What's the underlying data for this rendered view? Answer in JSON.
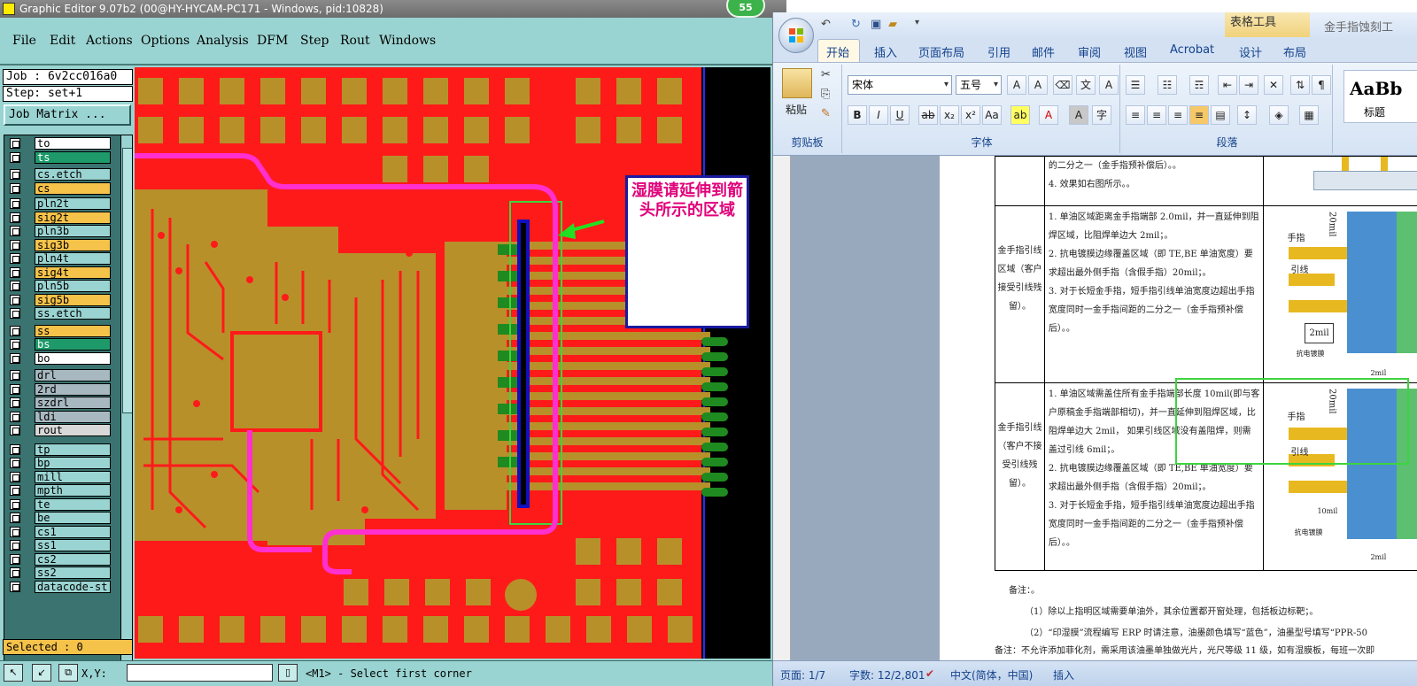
{
  "ge": {
    "title": "Graphic Editor 9.07b2 (00@HY-HYCAM-PC171 - Windows, pid:10828)",
    "badge": "55",
    "menu": [
      "File",
      "Edit",
      "Actions",
      "Options",
      "Analysis",
      "DFM",
      "Step",
      "Rout",
      "Windows"
    ],
    "job": "Job : 6v2cc016a0",
    "step": "Step: set+1",
    "job_matrix": "Job Matrix ...",
    "layers": [
      {
        "name": "to",
        "color": "#ffffff"
      },
      {
        "name": "ts",
        "color": "#1e9a6a"
      },
      {
        "name": "cs.etch",
        "color": "#9ad4d2"
      },
      {
        "name": "cs",
        "color": "#f5c24a"
      },
      {
        "name": "pln2t",
        "color": "#9ad4d2"
      },
      {
        "name": "sig2t",
        "color": "#f5c24a"
      },
      {
        "name": "pln3b",
        "color": "#9ad4d2"
      },
      {
        "name": "sig3b",
        "color": "#f5c24a"
      },
      {
        "name": "pln4t",
        "color": "#9ad4d2"
      },
      {
        "name": "sig4t",
        "color": "#f5c24a"
      },
      {
        "name": "pln5b",
        "color": "#9ad4d2"
      },
      {
        "name": "sig5b",
        "color": "#f5c24a"
      },
      {
        "name": "ss.etch",
        "color": "#9ad4d2"
      },
      {
        "name": "ss",
        "color": "#f5c24a"
      },
      {
        "name": "bs",
        "color": "#1e9a6a"
      },
      {
        "name": "bo",
        "color": "#ffffff"
      },
      {
        "name": "drl",
        "color": "#a8b8c0"
      },
      {
        "name": "2rd",
        "color": "#a8b8c0"
      },
      {
        "name": "szdrl",
        "color": "#a8b8c0"
      },
      {
        "name": "ldi",
        "color": "#a8b8c0"
      },
      {
        "name": "rout",
        "color": "#d8d8d8"
      },
      {
        "name": "tp",
        "color": "#9ad4d2"
      },
      {
        "name": "bp",
        "color": "#9ad4d2"
      },
      {
        "name": "mill",
        "color": "#9ad4d2"
      },
      {
        "name": "mpth",
        "color": "#9ad4d2"
      },
      {
        "name": "te",
        "color": "#9ad4d2"
      },
      {
        "name": "be",
        "color": "#9ad4d2"
      },
      {
        "name": "cs1",
        "color": "#9ad4d2"
      },
      {
        "name": "ss1",
        "color": "#9ad4d2"
      },
      {
        "name": "cs2",
        "color": "#9ad4d2"
      },
      {
        "name": "ss2",
        "color": "#9ad4d2"
      },
      {
        "name": "datacode-st",
        "color": "#9ad4d2"
      }
    ],
    "selected": "Selected : 0",
    "xy_label": "X,Y:",
    "status": "<M1> - Select first corner",
    "annotation": "湿膜请延伸到箭头所示的区域"
  },
  "word": {
    "context_tool": "表格工具",
    "doc_title": "金手指蚀刻工",
    "tabs": [
      "开始",
      "插入",
      "页面布局",
      "引用",
      "邮件",
      "审阅",
      "视图",
      "Acrobat",
      "设计",
      "布局"
    ],
    "font_name": "宋体",
    "font_size": "五号",
    "groups": [
      "剪贴板",
      "字体",
      "段落"
    ],
    "paste": "粘贴",
    "style_sample": "AaBb",
    "style_name": "标题",
    "row1_text": [
      "的二分之一（金手指预补偿后）。。",
      "4. 效果如右图所示。。"
    ],
    "row2_head": "金手指引线区域（客户接受引线残留）。",
    "row2_text": [
      "1. 单油区域距离金手指端部 2.0mil，并一直延伸到阻焊区域，比阻焊单边大 2mil；。",
      "2. 抗电镀膜边缘覆盖区域（即 TE,BE 单油宽度）要求超出最外侧手指（含假手指）20mil；。",
      "3. 对于长短金手指，短手指引线单油宽度边超出手指宽度同时一金手指间距的二分之一（金手指预补偿后）。。"
    ],
    "row3_head": "金手指引线（客户不接受引线残留）。",
    "row3_text": [
      "1. 单油区域需盖住所有金手指端部长度 10mil(即与客户原稿金手指端部相切)，并一直延伸到阻焊区域，比阻焊单边大 2mil， 如果引线区域没有盖阻焊，则需盖过引线 6mil；。",
      "2. 抗电镀膜边缘覆盖区域（即 TE,BE 单油宽度）要求超出最外侧手指（含假手指）20mil；。",
      "3. 对于长短金手指，短手指引线单油宽度边超出手指宽度同时一金手指间距的二分之一（金手指预补偿后）。。"
    ],
    "img_labels": {
      "finger": "手指",
      "lead": "引线",
      "film": "抗电镀膜",
      "mil20": "20mil",
      "mil2": "2mil",
      "mil10": "10mil"
    },
    "remark": "备注：。",
    "remark1": "（1）除以上指明区域需要单油外，其余位置都开窗处理，包括板边标靶；。",
    "remark2": "（2）“印湿膜”流程编写 ERP 时请注意，油墨颜色填写“蓝色”，油墨型号填写“PPR-50",
    "remark3": "备注：不允许添加菲化剂，需采用该油墨单独做光片，光尺等级 11 级，如有湿膜板，每班一次即",
    "status_page": "页面: 1/7",
    "status_words": "字数: 12/2,801",
    "status_lang": "中文(简体，中国)",
    "status_mode": "插入",
    "colors": {
      "board": "#ff1a1a",
      "copper": "#b8902a",
      "finger": "#1f8a1f",
      "outline": "#ff2fd0",
      "ribbon": "#15428b"
    }
  }
}
